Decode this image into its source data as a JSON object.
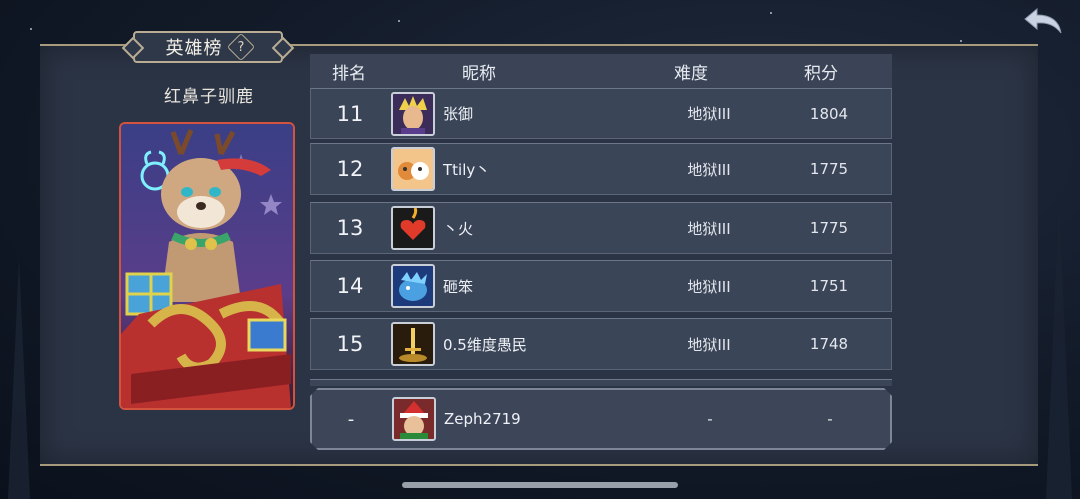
{
  "panel_title": "英雄榜",
  "help_glyph": "?",
  "hero": {
    "name": "红鼻子驯鹿"
  },
  "table": {
    "headers": {
      "rank": "排名",
      "nickname": "昵称",
      "difficulty": "难度",
      "score": "积分"
    },
    "rows": [
      {
        "rank": "11",
        "nickname": "张御",
        "difficulty": "地狱III",
        "score": "1804"
      },
      {
        "rank": "12",
        "nickname": "Ttily丶",
        "difficulty": "地狱III",
        "score": "1775"
      },
      {
        "rank": "13",
        "nickname": "丶火",
        "difficulty": "地狱III",
        "score": "1775"
      },
      {
        "rank": "14",
        "nickname": "砸笨",
        "difficulty": "地狱III",
        "score": "1751"
      },
      {
        "rank": "15",
        "nickname": "0.5维度愚民",
        "difficulty": "地狱III",
        "score": "1748"
      }
    ],
    "self_row": {
      "rank": "-",
      "nickname": "Zeph2719",
      "difficulty": "-",
      "score": "-"
    }
  },
  "colors": {
    "card_border": "#d4533f",
    "panel_bg": "#2b3445",
    "trim": "#a89a7c"
  }
}
